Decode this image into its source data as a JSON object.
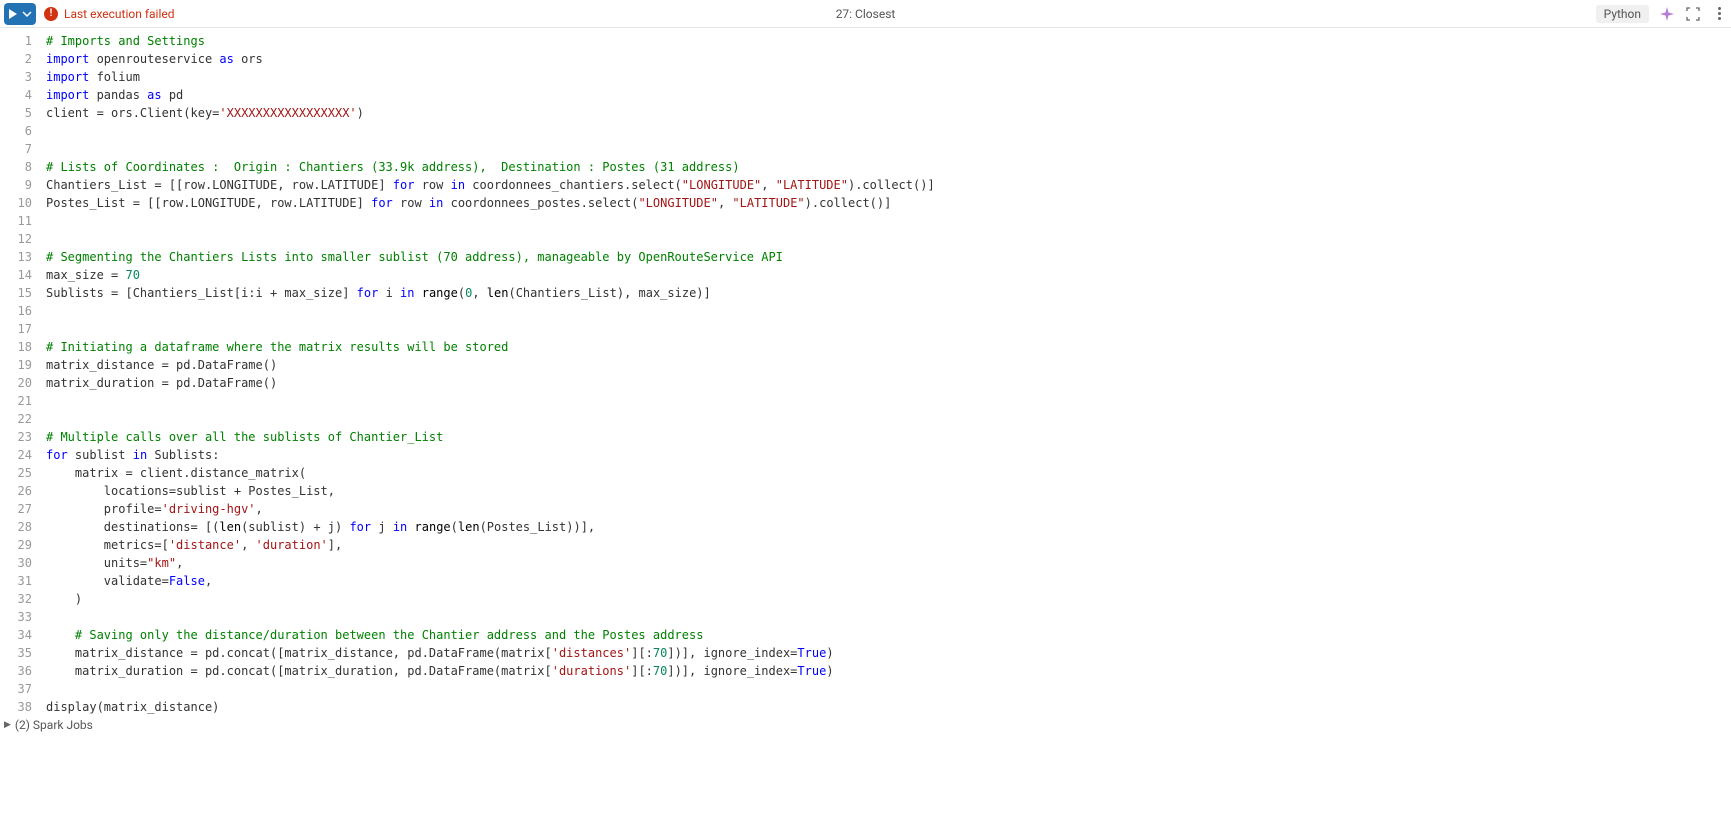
{
  "toolbar": {
    "error_text": "Last execution failed",
    "cell_title": "27: Closest",
    "language": "Python"
  },
  "code": {
    "lines": [
      {
        "n": 1,
        "segs": [
          [
            "c-com",
            "# Imports and Settings"
          ]
        ]
      },
      {
        "n": 2,
        "segs": [
          [
            "c-key",
            "import"
          ],
          [
            "",
            " openrouteservice "
          ],
          [
            "c-key",
            "as"
          ],
          [
            "",
            " ors"
          ]
        ]
      },
      {
        "n": 3,
        "segs": [
          [
            "c-key",
            "import"
          ],
          [
            "",
            " folium"
          ]
        ]
      },
      {
        "n": 4,
        "segs": [
          [
            "c-key",
            "import"
          ],
          [
            "",
            " pandas "
          ],
          [
            "c-key",
            "as"
          ],
          [
            "",
            " pd"
          ]
        ]
      },
      {
        "n": 5,
        "segs": [
          [
            "",
            "client = ors.Client(key="
          ],
          [
            "c-str",
            "'XXXXXXXXXXXXXXXXX'"
          ],
          [
            "",
            ")"
          ]
        ]
      },
      {
        "n": 6,
        "segs": [
          [
            "",
            ""
          ]
        ]
      },
      {
        "n": 7,
        "segs": [
          [
            "",
            ""
          ]
        ]
      },
      {
        "n": 8,
        "segs": [
          [
            "c-com",
            "# Lists of Coordinates :  Origin : Chantiers (33.9k address),  Destination : Postes (31 address)"
          ]
        ]
      },
      {
        "n": 9,
        "segs": [
          [
            "",
            "Chantiers_List = [[row.LONGITUDE, row.LATITUDE] "
          ],
          [
            "c-key",
            "for"
          ],
          [
            "",
            " row "
          ],
          [
            "c-key",
            "in"
          ],
          [
            "",
            " coordonnees_chantiers.select("
          ],
          [
            "c-str",
            "\"LONGITUDE\""
          ],
          [
            "",
            ", "
          ],
          [
            "c-str",
            "\"LATITUDE\""
          ],
          [
            "",
            ").collect()]"
          ]
        ]
      },
      {
        "n": 10,
        "segs": [
          [
            "",
            "Postes_List = [[row.LONGITUDE, row.LATITUDE] "
          ],
          [
            "c-key",
            "for"
          ],
          [
            "",
            " row "
          ],
          [
            "c-key",
            "in"
          ],
          [
            "",
            " coordonnees_postes.select("
          ],
          [
            "c-str",
            "\"LONGITUDE\""
          ],
          [
            "",
            ", "
          ],
          [
            "c-str",
            "\"LATITUDE\""
          ],
          [
            "",
            ").collect()]"
          ]
        ]
      },
      {
        "n": 11,
        "segs": [
          [
            "",
            ""
          ]
        ]
      },
      {
        "n": 12,
        "segs": [
          [
            "",
            ""
          ]
        ]
      },
      {
        "n": 13,
        "segs": [
          [
            "c-com",
            "# Segmenting the Chantiers Lists into smaller sublist (70 address), manageable by OpenRouteService API"
          ]
        ]
      },
      {
        "n": 14,
        "segs": [
          [
            "",
            "max_size = "
          ],
          [
            "c-num",
            "70"
          ]
        ]
      },
      {
        "n": 15,
        "segs": [
          [
            "",
            "Sublists = [Chantiers_List[i:i + max_size] "
          ],
          [
            "c-key",
            "for"
          ],
          [
            "",
            " i "
          ],
          [
            "c-key",
            "in"
          ],
          [
            "",
            " "
          ],
          [
            "c-fn",
            "range"
          ],
          [
            "",
            "("
          ],
          [
            "c-num",
            "0"
          ],
          [
            "",
            ", "
          ],
          [
            "c-fn",
            "len"
          ],
          [
            "",
            "(Chantiers_List), max_size)]"
          ]
        ]
      },
      {
        "n": 16,
        "segs": [
          [
            "",
            ""
          ]
        ]
      },
      {
        "n": 17,
        "segs": [
          [
            "",
            ""
          ]
        ]
      },
      {
        "n": 18,
        "segs": [
          [
            "c-com",
            "# Initiating a dataframe where the matrix results will be stored"
          ]
        ]
      },
      {
        "n": 19,
        "segs": [
          [
            "",
            "matrix_distance = pd.DataFrame()"
          ]
        ]
      },
      {
        "n": 20,
        "segs": [
          [
            "",
            "matrix_duration = pd.DataFrame()"
          ]
        ]
      },
      {
        "n": 21,
        "segs": [
          [
            "",
            ""
          ]
        ]
      },
      {
        "n": 22,
        "segs": [
          [
            "",
            ""
          ]
        ]
      },
      {
        "n": 23,
        "segs": [
          [
            "c-com",
            "# Multiple calls over all the sublists of Chantier_List"
          ]
        ]
      },
      {
        "n": 24,
        "segs": [
          [
            "c-key",
            "for"
          ],
          [
            "",
            " sublist "
          ],
          [
            "c-key",
            "in"
          ],
          [
            "",
            " Sublists:"
          ]
        ]
      },
      {
        "n": 25,
        "indent": 1,
        "segs": [
          [
            "",
            "matrix = client.distance_matrix("
          ]
        ]
      },
      {
        "n": 26,
        "indent": 2,
        "segs": [
          [
            "",
            "locations=sublist + Postes_List,"
          ]
        ]
      },
      {
        "n": 27,
        "indent": 2,
        "segs": [
          [
            "",
            "profile="
          ],
          [
            "c-str",
            "'driving-hgv'"
          ],
          [
            "",
            ","
          ]
        ]
      },
      {
        "n": 28,
        "indent": 2,
        "segs": [
          [
            "",
            "destinations= [("
          ],
          [
            "c-fn",
            "len"
          ],
          [
            "",
            "(sublist) + j) "
          ],
          [
            "c-key",
            "for"
          ],
          [
            "",
            " j "
          ],
          [
            "c-key",
            "in"
          ],
          [
            "",
            " "
          ],
          [
            "c-fn",
            "range"
          ],
          [
            "",
            "("
          ],
          [
            "c-fn",
            "len"
          ],
          [
            "",
            "(Postes_List))],"
          ]
        ]
      },
      {
        "n": 29,
        "indent": 2,
        "segs": [
          [
            "",
            "metrics=["
          ],
          [
            "c-str",
            "'distance'"
          ],
          [
            "",
            ", "
          ],
          [
            "c-str",
            "'duration'"
          ],
          [
            "",
            "],"
          ]
        ]
      },
      {
        "n": 30,
        "indent": 2,
        "segs": [
          [
            "",
            "units="
          ],
          [
            "c-str",
            "\"km\""
          ],
          [
            "",
            ","
          ]
        ]
      },
      {
        "n": 31,
        "indent": 2,
        "segs": [
          [
            "",
            "validate="
          ],
          [
            "c-key",
            "False"
          ],
          [
            "",
            ","
          ]
        ]
      },
      {
        "n": 32,
        "indent": 1,
        "segs": [
          [
            "",
            ")"
          ]
        ]
      },
      {
        "n": 33,
        "indent": 0,
        "segs": [
          [
            "",
            ""
          ]
        ]
      },
      {
        "n": 34,
        "indent": 1,
        "segs": [
          [
            "c-com",
            "# Saving only the distance/duration between the Chantier address and the Postes address"
          ]
        ]
      },
      {
        "n": 35,
        "indent": 1,
        "segs": [
          [
            "",
            "matrix_distance = pd.concat([matrix_distance, pd.DataFrame(matrix["
          ],
          [
            "c-str",
            "'distances'"
          ],
          [
            "",
            "][:"
          ],
          [
            "c-num",
            "70"
          ],
          [
            "",
            "])], ignore_index="
          ],
          [
            "c-key",
            "True"
          ],
          [
            "",
            ")"
          ]
        ]
      },
      {
        "n": 36,
        "indent": 1,
        "segs": [
          [
            "",
            "matrix_duration = pd.concat([matrix_duration, pd.DataFrame(matrix["
          ],
          [
            "c-str",
            "'durations'"
          ],
          [
            "",
            "][:"
          ],
          [
            "c-num",
            "70"
          ],
          [
            "",
            "])], ignore_index="
          ],
          [
            "c-key",
            "True"
          ],
          [
            "",
            ")"
          ]
        ]
      },
      {
        "n": 37,
        "segs": [
          [
            "",
            ""
          ]
        ]
      },
      {
        "n": 38,
        "segs": [
          [
            "",
            "display(matrix_distance)"
          ]
        ]
      }
    ]
  },
  "footer": {
    "text": "(2) Spark Jobs"
  }
}
